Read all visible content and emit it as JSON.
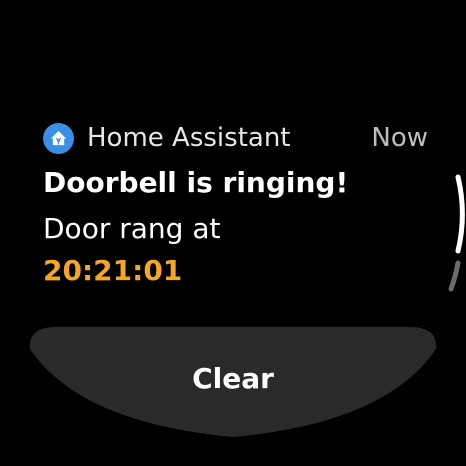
{
  "notification": {
    "app_name": "Home Assistant",
    "app_icon": "home-assistant-icon",
    "time": "Now",
    "title": "Doorbell is ringing!",
    "body": "Door rang at",
    "highlight": "20:21:01",
    "highlight_color": "#f5a623"
  },
  "actions": {
    "clear_label": "Clear"
  },
  "colors": {
    "background": "#000000",
    "icon_background": "#3a8ee6",
    "button_background": "#2a2a2a"
  }
}
